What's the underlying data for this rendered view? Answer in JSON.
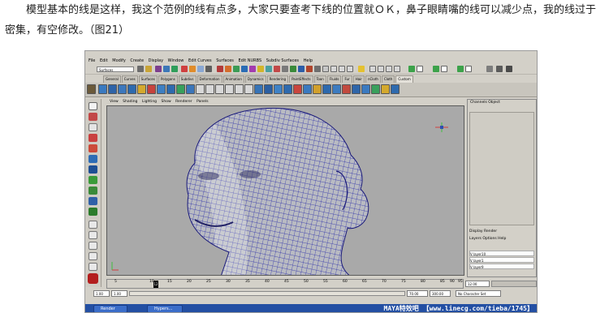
{
  "paragraph": {
    "text": "模型基本的线是这样，我这个范例的线有点多，大家只要查考下线的位置就ＯＫ，鼻子眼睛嘴的线可以减少点，我的线过于密集，有空修改。（图21）"
  },
  "maya": {
    "menus": [
      "File",
      "Edit",
      "Modify",
      "Create",
      "Display",
      "Window",
      "Edit Curves",
      "Surfaces",
      "Edit NURBS",
      "Subdiv Surfaces",
      "Help"
    ],
    "mode_selector": "Surfaces",
    "shelf_tabs": [
      "General",
      "Curves",
      "Surfaces",
      "Polygons",
      "Subdivs",
      "Deformation",
      "Animation",
      "Dynamics",
      "Rendering",
      "PaintEffects",
      "Toon",
      "Fluids",
      "Fur",
      "Hair",
      "nCloth",
      "Cloth",
      "Custom"
    ],
    "active_shelf_tab": "Custom",
    "panel_menus": [
      "View",
      "Shading",
      "Lighting",
      "Show",
      "Renderer",
      "Panels"
    ],
    "channel_box": {
      "tabs": [
        "Channels",
        "Object"
      ],
      "display_tabs": [
        "Display",
        "Render"
      ],
      "layer_menus": [
        "Layers",
        "Options",
        "Help"
      ],
      "layers": [
        "layer10",
        "layer1",
        "layer9"
      ]
    },
    "timeline": {
      "ticks": [
        "5",
        "10",
        "15",
        "20",
        "25",
        "30",
        "35",
        "40",
        "45",
        "50",
        "55",
        "60",
        "65",
        "70",
        "75",
        "80",
        "85",
        "90",
        "95"
      ],
      "current_frame": "12",
      "end_field": "12.00"
    },
    "range": {
      "start": "1.00",
      "start2": "1.00",
      "end": "70.00",
      "end2": "300.00",
      "char_set": "No Character Set"
    },
    "taskbar": {
      "items": [
        "Render",
        "Hypers..."
      ]
    },
    "watermark": "MAYA特效吧 【www.linecg.com/tieba/1745】"
  }
}
